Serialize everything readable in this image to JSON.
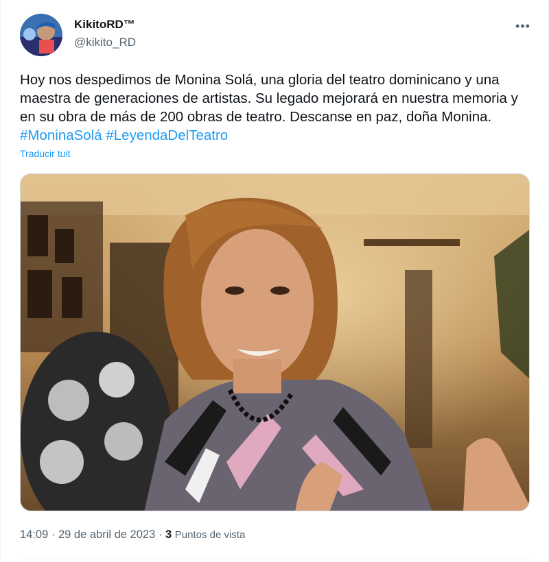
{
  "author": {
    "display_name": "KikitoRD™",
    "handle": "@kikito_RD"
  },
  "more_icon": "•••",
  "tweet": {
    "text": "Hoy nos despedimos de Monina Solá, una gloria del teatro dominicano y una maestra de generaciones de artistas. Su legado mejorará en nuestra memoria y en su obra de más de 200 obras de teatro. Descanse en paz, doña Monina.",
    "hashtags": [
      "#MoninaSolá",
      "#LeyendaDelTeatro"
    ],
    "translate_label": "Traducir tuit"
  },
  "meta": {
    "time": "14:09",
    "separator": "·",
    "date": "29 de abril de 2023",
    "views_count": "3",
    "views_label": "Puntos de vista"
  },
  "colors": {
    "link": "#1d9bf0",
    "text": "#0f1419",
    "secondary": "#536471"
  }
}
